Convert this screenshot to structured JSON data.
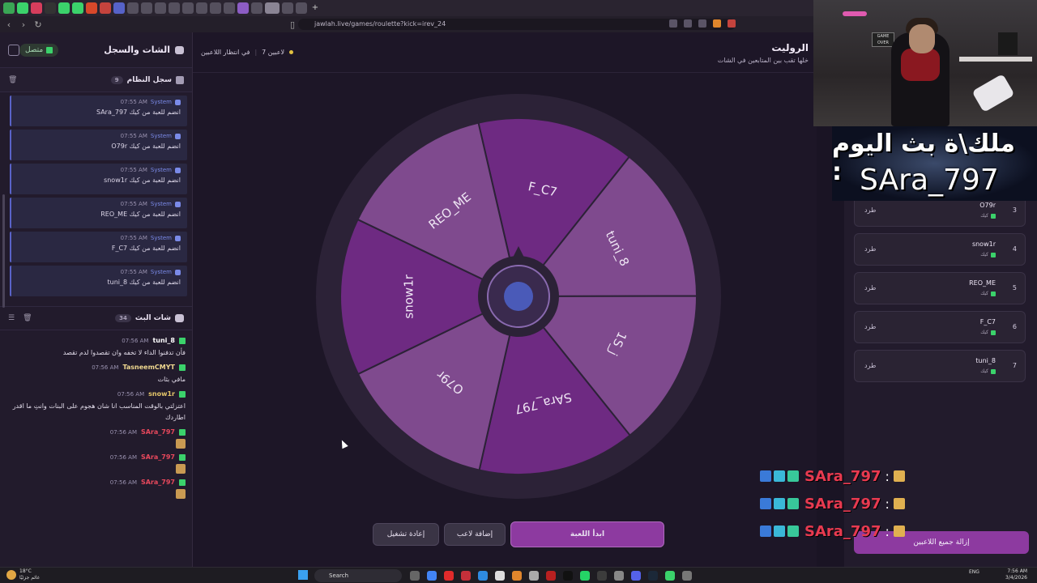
{
  "browser": {
    "url": "jawlah.live/games/roulette?kick=irev_24"
  },
  "left_panel": {
    "title": "الشات والسجل",
    "status": "متصل",
    "system_log": {
      "title": "سجل النظام",
      "count": "9",
      "entries": [
        {
          "name": "System",
          "time": "07:55 AM",
          "text": "SAra_797 انضم للعبة من كيك"
        },
        {
          "name": "System",
          "time": "07:55 AM",
          "text": "O79r انضم للعبة من كيك"
        },
        {
          "name": "System",
          "time": "07:55 AM",
          "text": "snow1r انضم للعبة من كيك"
        },
        {
          "name": "System",
          "time": "07:55 AM",
          "text": "REO_ME انضم للعبة من كيك"
        },
        {
          "name": "System",
          "time": "07:55 AM",
          "text": "F_C7 انضم للعبة من كيك"
        },
        {
          "name": "System",
          "time": "07:55 AM",
          "text": "tuni_8 انضم للعبة من كيك"
        }
      ]
    },
    "live_chat": {
      "title": "شات البث",
      "count": "34",
      "messages": [
        {
          "user": "tuni_8",
          "time": "07:56 AM",
          "text": "فأن تدفنوا الداء لا تخفه وان تقصدوا لدم تقصد",
          "color": "#ffffff",
          "emote": false
        },
        {
          "user": "TasneemCMYT",
          "time": "07:56 AM",
          "text": "مافي بثات",
          "color": "#f0d890",
          "emote": false
        },
        {
          "user": "snow1r",
          "time": "07:56 AM",
          "text": "اعتزلتي بالوقت المناسب انا شان هجوم على البنات وانتِ ما اقدر اطاردك",
          "color": "#e6c76a",
          "emote": false
        },
        {
          "user": "SAra_797",
          "time": "07:56 AM",
          "text": "",
          "color": "#e8485c",
          "emote": true
        },
        {
          "user": "SAra_797",
          "time": "07:56 AM",
          "text": "",
          "color": "#e8485c",
          "emote": true
        },
        {
          "user": "SAra_797",
          "time": "07:56 AM",
          "text": "",
          "color": "#e8485c",
          "emote": true
        }
      ]
    }
  },
  "main": {
    "title": "الروليت",
    "subtitle": "خلها تقب بين المتابعين في الشات",
    "waiting_label": "في انتظار اللاعبين",
    "players_count": "7 لاعبين",
    "wheel_segments": [
      "F_C7",
      "tuni_8",
      "1S_j",
      "SAra_797",
      "O79r",
      "snow1r",
      "REO_ME"
    ],
    "wheel_colors": [
      "#6e2a82",
      "#7f4a8e",
      "#7f4a8e",
      "#6e2a82",
      "#7f4a8e",
      "#6e2a82",
      "#7f4a8e"
    ],
    "buttons": {
      "start": "ابدأ اللعبة",
      "add_player": "إضافة لاعب",
      "restart": "إعادة تشغيل"
    }
  },
  "right_panel": {
    "players": [
      {
        "rank": "3",
        "name": "O79r",
        "source": "كيك",
        "kick_label": "طرد"
      },
      {
        "rank": "4",
        "name": "snow1r",
        "source": "كيك",
        "kick_label": "طرد"
      },
      {
        "rank": "5",
        "name": "REO_ME",
        "source": "كيك",
        "kick_label": "طرد"
      },
      {
        "rank": "6",
        "name": "F_C7",
        "source": "كيك",
        "kick_label": "طرد"
      },
      {
        "rank": "7",
        "name": "tuni_8",
        "source": "كيك",
        "kick_label": "طرد"
      }
    ],
    "remove_all": "إزالة جميع اللاعبين"
  },
  "overlay": {
    "crown_line1": "ملك\\ة بث اليوم :",
    "crown_line2": "SAra_797",
    "alerts": [
      "SAra_797",
      "SAra_797",
      "SAra_797"
    ],
    "alert_separator": ":"
  },
  "taskbar": {
    "weather_temp": "18°C",
    "weather_desc": "غائم جزئيًا",
    "search_placeholder": "Search",
    "lang": "ENG",
    "time": "7:56 AM",
    "date": "3/4/2026"
  }
}
